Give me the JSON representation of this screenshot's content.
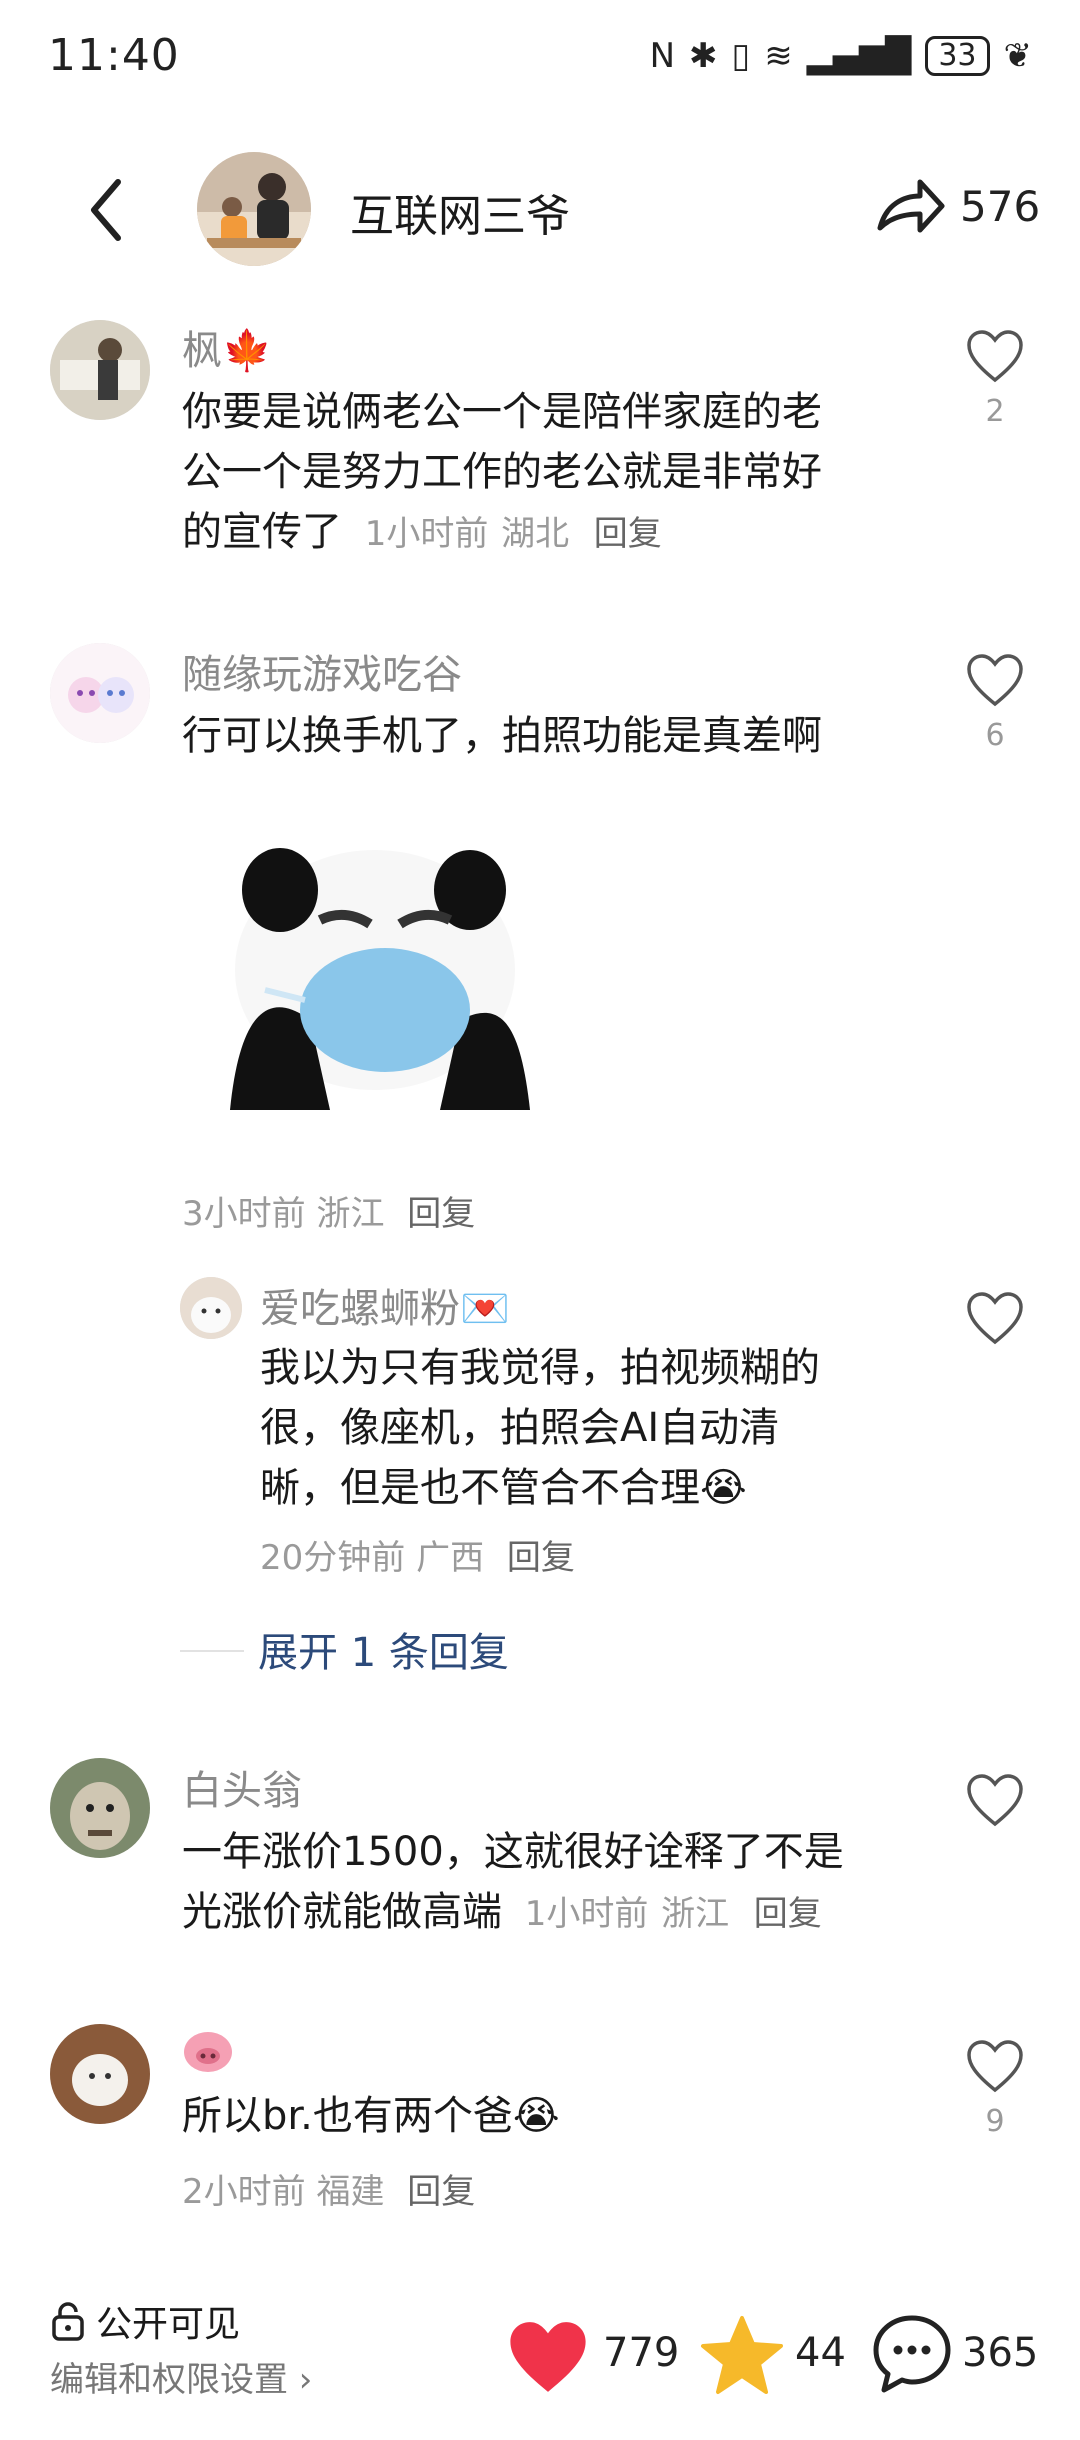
{
  "status": {
    "time": "11:40",
    "battery": "33"
  },
  "header": {
    "author": "互联网三爷",
    "share_count": "576"
  },
  "comments": [
    {
      "user": "枫",
      "text_lines": [
        "你要是说俩老公一个是陪伴家庭的老",
        "公一个是努力工作的老公就是非常好",
        "的宣传了"
      ],
      "time": "1小时前",
      "location": "湖北",
      "reply": "回复",
      "likes": "2"
    },
    {
      "user": "随缘玩游戏吃谷",
      "text_lines": [
        "行可以换手机了，拍照功能是真差啊"
      ],
      "time": "3小时前",
      "location": "浙江",
      "reply": "回复",
      "likes": "6"
    },
    {
      "user": "白头翁",
      "text_lines": [
        "一年涨价1500，这就很好诠释了不是",
        "光涨价就能做高端"
      ],
      "time": "1小时前",
      "location": "浙江",
      "reply": "回复",
      "likes": ""
    },
    {
      "user": "",
      "text_lines": [
        "所以br.也有两个爸"
      ],
      "time": "2小时前",
      "location": "福建",
      "reply": "回复",
      "likes": "9"
    }
  ],
  "subreply": {
    "user": "爱吃螺蛳粉",
    "text_lines": [
      "我以为只有我觉得，拍视频糊的",
      "很，像座机，拍照会AI自动清",
      "晰，但是也不管合不合理"
    ],
    "time": "20分钟前",
    "location": "广西",
    "reply": "回复"
  },
  "expand_label": "展开 1 条回复",
  "bottom": {
    "visibility": "公开可见",
    "edit": "编辑和权限设置",
    "likes": "779",
    "favorites": "44",
    "comments": "365"
  },
  "colors": {
    "heart": "#f0334a",
    "star": "#f6b92a",
    "link": "#2c4a7a"
  },
  "icons": [
    "back-icon",
    "share-icon",
    "heart-outline-icon",
    "lock-icon",
    "heart-filled-icon",
    "star-icon",
    "comment-icon",
    "maple-leaf-icon",
    "envelope-heart-icon",
    "pig-icon",
    "crying-emoji-icon"
  ]
}
